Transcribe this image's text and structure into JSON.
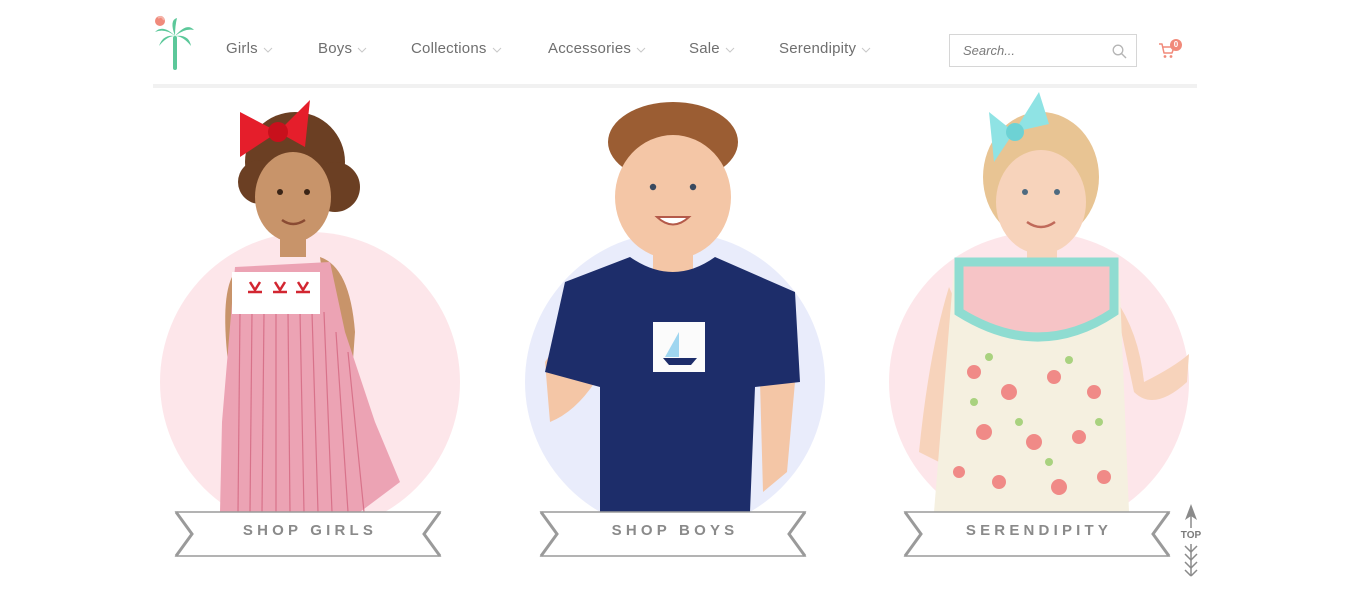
{
  "header": {
    "nav": [
      {
        "label": "Girls"
      },
      {
        "label": "Boys"
      },
      {
        "label": "Collections"
      },
      {
        "label": "Accessories"
      },
      {
        "label": "Sale"
      },
      {
        "label": "Serendipity"
      }
    ],
    "search": {
      "placeholder": "Search..."
    },
    "cart": {
      "count": "0"
    }
  },
  "tiles": [
    {
      "label": "SHOP GIRLS",
      "circle_color": "#fde6ea"
    },
    {
      "label": "SHOP BOYS",
      "circle_color": "#e9ecfb"
    },
    {
      "label": "SERENDIPITY",
      "circle_color": "#fde6ea"
    }
  ],
  "back_to_top": {
    "label": "TOP"
  },
  "colors": {
    "nav_text": "#6f6f6f",
    "logo_green": "#5cc89a",
    "cart_accent": "#f18a7a",
    "banner_text": "#8a8a8a"
  }
}
